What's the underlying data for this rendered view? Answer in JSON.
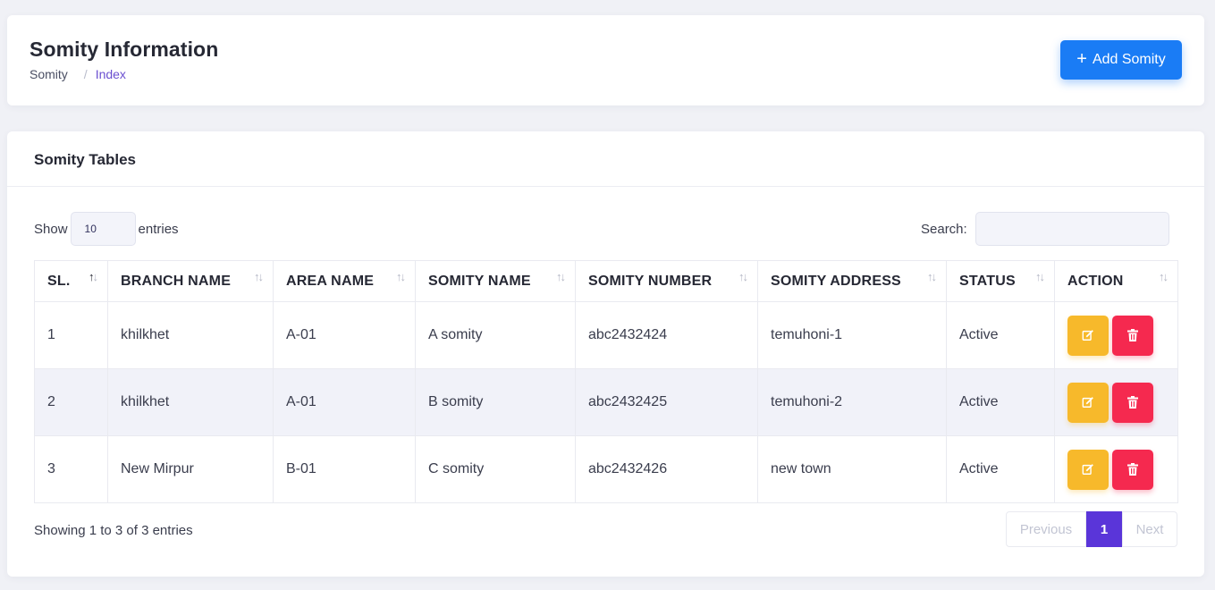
{
  "header": {
    "title": "Somity Information",
    "breadcrumb": {
      "item1": "Somity",
      "separator": "/",
      "active": "Index"
    },
    "add_button": {
      "icon": "+",
      "label": "Add Somity"
    }
  },
  "table_card": {
    "title": "Somity Tables",
    "length": {
      "prefix": "Show",
      "value": "10",
      "suffix": "entries"
    },
    "search": {
      "label": "Search:",
      "value": ""
    },
    "columns": [
      "SL.",
      "BRANCH NAME",
      "AREA NAME",
      "SOMITY NAME",
      "SOMITY NUMBER",
      "SOMITY ADDRESS",
      "STATUS",
      "ACTION"
    ],
    "sort_icon": "↑↓",
    "rows": [
      {
        "sl": "1",
        "branch": "khilkhet",
        "area": "A-01",
        "somity_name": "A somity",
        "somity_number": "abc2432424",
        "address": "temuhoni-1",
        "status": "Active"
      },
      {
        "sl": "2",
        "branch": "khilkhet",
        "area": "A-01",
        "somity_name": "B somity",
        "somity_number": "abc2432425",
        "address": "temuhoni-2",
        "status": "Active"
      },
      {
        "sl": "3",
        "branch": "New Mirpur",
        "area": "B-01",
        "somity_name": "C somity",
        "somity_number": "abc2432426",
        "address": "new town",
        "status": "Active"
      }
    ],
    "info": "Showing 1 to 3 of 3 entries",
    "pagination": {
      "previous": "Previous",
      "current": "1",
      "next": "Next"
    }
  },
  "icons": {
    "edit": "edit-icon",
    "delete": "trash-icon",
    "sort": "sort-icon",
    "add": "plus-icon"
  },
  "colors": {
    "primary": "#1a7cf5",
    "active_page": "#5a35d9",
    "edit": "#f7b92b",
    "delete": "#f5294f",
    "breadcrumb_active": "#6a4fd0"
  }
}
